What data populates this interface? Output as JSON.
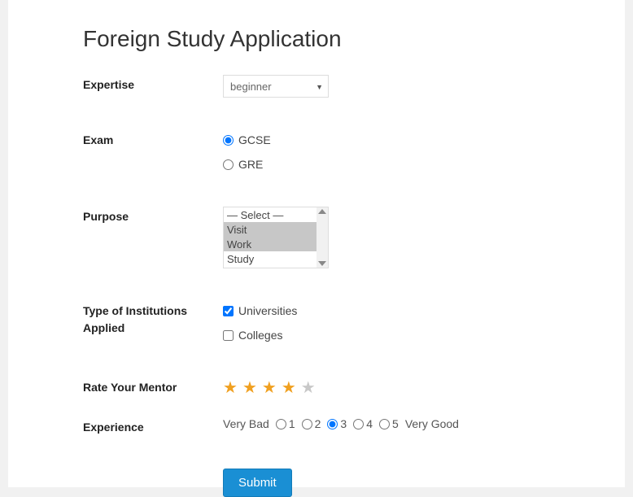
{
  "title": "Foreign Study Application",
  "expertise": {
    "label": "Expertise",
    "value": "beginner"
  },
  "exam": {
    "label": "Exam",
    "options": [
      {
        "label": "GCSE",
        "checked": true
      },
      {
        "label": "GRE",
        "checked": false
      }
    ]
  },
  "purpose": {
    "label": "Purpose",
    "options": [
      {
        "label": "— Select —",
        "selected": false
      },
      {
        "label": "Visit",
        "selected": true
      },
      {
        "label": "Work",
        "selected": true
      },
      {
        "label": "Study",
        "selected": false
      }
    ]
  },
  "institutions": {
    "label": "Type of Institutions Applied",
    "options": [
      {
        "label": "Universities",
        "checked": true
      },
      {
        "label": "Colleges",
        "checked": false
      }
    ]
  },
  "mentor": {
    "label": "Rate Your Mentor",
    "rating": 4,
    "max": 5
  },
  "experience": {
    "label": "Experience",
    "leading": "Very Bad",
    "trailing": "Very Good",
    "options": [
      "1",
      "2",
      "3",
      "4",
      "5"
    ],
    "checked": "3"
  },
  "submit": "Submit"
}
